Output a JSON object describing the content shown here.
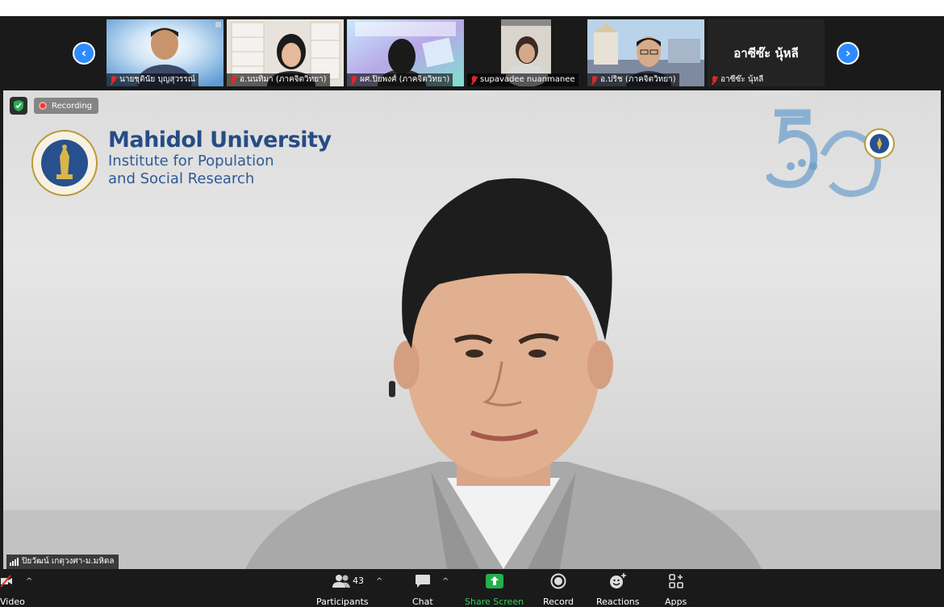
{
  "gallery": {
    "tiles": [
      {
        "name": "นายชุตินัย บุญสุวรรณ์",
        "muted": true
      },
      {
        "name": "อ.นนทิมา (ภาคจิตวิทยา)",
        "muted": true
      },
      {
        "name": "ผศ.ปิยพงศ์ (ภาคจิตวิทยา)",
        "muted": true
      },
      {
        "name": "supavadee nuanmanee",
        "muted": true
      },
      {
        "name": "อ.ปริช (ภาคจิตวิทยา)",
        "muted": true
      },
      {
        "name": "อาซีซ๊ะ นุ้หลี",
        "display": "อาซีซ๊ะ นุ้หลี",
        "muted": true
      }
    ]
  },
  "recording": {
    "label": "Recording"
  },
  "background": {
    "institution": "Mahidol University",
    "unit_line1": "Institute for Population",
    "unit_line2": "and Social Research"
  },
  "speaker": {
    "name": "ปิยวัฒน์ เกตุวงศา-ม.มหิดล"
  },
  "toolbar": {
    "video": "Video",
    "participants": "Participants",
    "participants_count": "43",
    "chat": "Chat",
    "share": "Share Screen",
    "record": "Record",
    "reactions": "Reactions",
    "apps": "Apps"
  },
  "colors": {
    "accent": "#2d8cff",
    "share": "#22b14c",
    "brand": "#254c85",
    "muted": "#e02828"
  }
}
